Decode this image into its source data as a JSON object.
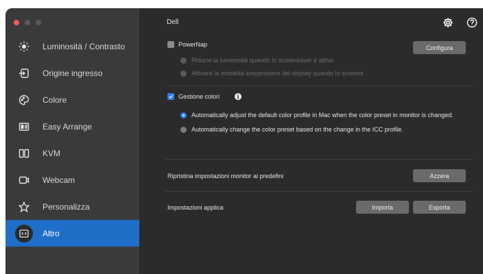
{
  "sidebar": {
    "items": [
      {
        "label": "Luminosità / Contrasto",
        "icon": "brightness-icon"
      },
      {
        "label": "Origine ingresso",
        "icon": "input-source-icon"
      },
      {
        "label": "Colore",
        "icon": "palette-icon"
      },
      {
        "label": "Easy Arrange",
        "icon": "easy-arrange-icon"
      },
      {
        "label": "KVM",
        "icon": "kvm-icon"
      },
      {
        "label": "Webcam",
        "icon": "webcam-icon"
      },
      {
        "label": "Personalizza",
        "icon": "star-icon"
      },
      {
        "label": "Altro",
        "icon": "other-icon",
        "active": true
      }
    ]
  },
  "main": {
    "title": "Dell",
    "powernap": {
      "label": "PowerNap",
      "checked": false,
      "options": [
        "Ridurre la luminosità quando lo screensaver è attivo",
        "Attivare la modalità sospensione del display quando lo screens"
      ],
      "button": "Configura"
    },
    "color_management": {
      "label": "Gestione colori",
      "checked": true,
      "options": [
        "Automatically adjust the default color profile in Mac when the color preset in monitor is changed.",
        "Automatically change the color preset based on the change in the ICC profile."
      ],
      "selected_index": 0
    },
    "reset": {
      "label": "Ripristina impostazioni monitor ai predefini",
      "button": "Azzera"
    },
    "apply_settings": {
      "label": "Impostazioni applica",
      "import_button": "Importa",
      "export_button": "Esporta"
    }
  },
  "colors": {
    "accent": "#1f6ec7",
    "checkbox_on": "#2b7df1",
    "button_bg": "#6a6a6a",
    "sidebar_bg": "#3a3a3a",
    "main_bg": "#2b2b2b"
  }
}
